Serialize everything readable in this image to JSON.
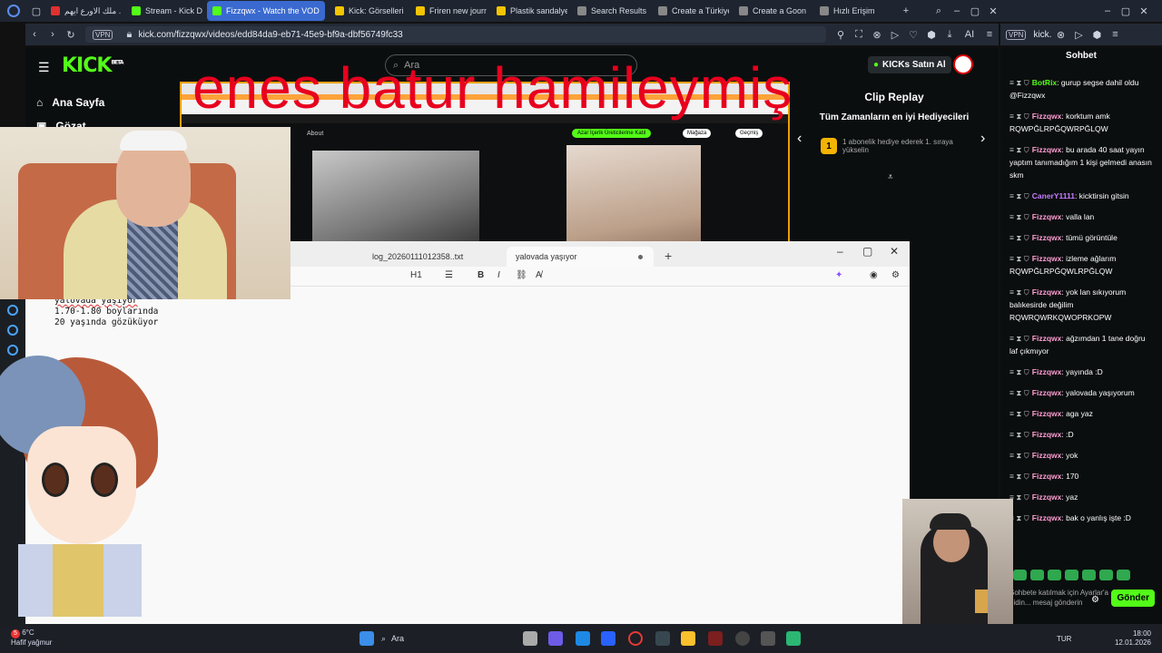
{
  "browser": {
    "tabs": [
      {
        "label": "ملك الاورع ايهم ...",
        "color": "#e03030"
      },
      {
        "label": "Stream - Kick D",
        "color": "#53fc18"
      },
      {
        "label": "Fizzqwx - Watch the VOD",
        "color": "#53fc18"
      },
      {
        "label": "Kick: Görselleri",
        "color": "#f5c400"
      },
      {
        "label": "Friren new journ",
        "color": "#f5c400"
      },
      {
        "label": "Plastik sandalye",
        "color": "#f5c400"
      },
      {
        "label": "Search Results",
        "color": "#888888"
      },
      {
        "label": "Create a Türkiye",
        "color": "#888888"
      },
      {
        "label": "Create a Goon",
        "color": "#888888"
      },
      {
        "label": "Hızlı Erişim",
        "color": "#888888"
      }
    ],
    "url": "kick.com/fizzqwx/videos/edd84da9-eb71-45e9-bf9a-dbf56749fc33",
    "vpn_label": "VPN",
    "second_window_url": "kick.",
    "second_vpn_label": "VPN",
    "ai_label": "AI"
  },
  "kick": {
    "logo": "KICK",
    "beta": "BETA",
    "search_placeholder": "Ara",
    "nav_home": "Ana Sayfa",
    "nav_browse": "Gözat",
    "kicks_button": "KICKs Satın Al",
    "overlay_text": "enes batur hamileymiş",
    "leaderboard_title": "Clip Replay",
    "leaderboard_subtitle": "Tüm Zamanların en iyi Hediyecileri",
    "leaderboard_rank": "1",
    "leaderboard_hint": "1 abonelik hediye ederek 1. sıraya yükselin",
    "screen_about": "About",
    "screen_green_btn": "Azar İçerik Üreticilerine Katıl",
    "screen_store": "Mağaza",
    "screen_history": "Geçmiş"
  },
  "notepad": {
    "tab1": "log_20260111012358..txt",
    "tab2": "yalovada yaşıyor",
    "heading_btn": "H1",
    "lines": [
      "yalovada yaşıyor",
      "1.70-1.80 boylarında",
      "20 yaşında gözüküyor"
    ]
  },
  "chat": {
    "title": "Sohbet",
    "messages": [
      {
        "user": "BotRix",
        "text": "gurup segse dahil oldu @Fizzqwx",
        "style": "green"
      },
      {
        "user": "Fizzqwx",
        "text": "korktum amk RQWPĞLRPĞQWRPĞLQW",
        "style": "pink"
      },
      {
        "user": "Fizzqwx",
        "text": "bu arada 40 saat yayın yaptım tanımadığım 1 kişi gelmedi anasın skm",
        "style": "pink"
      },
      {
        "user": "CanerY1111",
        "text": "kicktirsin gitsin",
        "style": "blue"
      },
      {
        "user": "Fizzqwx",
        "text": "valla lan",
        "style": "pink"
      },
      {
        "user": "Fizzqwx",
        "text": "tümü görüntüle",
        "style": "pink"
      },
      {
        "user": "Fizzqwx",
        "text": "izleme ağlarım RQWPĞLRPĞQWLRPĞLQW",
        "style": "pink"
      },
      {
        "user": "Fizzqwx",
        "text": "yok lan sıkıyorum balıkesirde değilim RQWRQWRKQWOPRKOPW",
        "style": "pink"
      },
      {
        "user": "Fizzqwx",
        "text": "ağzımdan 1 tane doğru laf çıkmıyor",
        "style": "pink"
      },
      {
        "user": "Fizzqwx",
        "text": "yayında :D",
        "style": "pink"
      },
      {
        "user": "Fizzqwx",
        "text": "yalovada yaşıyorum",
        "style": "pink"
      },
      {
        "user": "Fizzqwx",
        "text": "aga yaz",
        "style": "pink"
      },
      {
        "user": "Fizzqwx",
        "text": ":D",
        "style": "pink"
      },
      {
        "user": "Fizzqwx",
        "text": "yok",
        "style": "pink"
      },
      {
        "user": "Fizzqwx",
        "text": "170",
        "style": "pink"
      },
      {
        "user": "Fizzqwx",
        "text": "yaz",
        "style": "pink"
      },
      {
        "user": "Fizzqwx",
        "text": "bak o yanlış işte :D",
        "style": "pink"
      }
    ],
    "input_hint": "Sohbete katılmak için Ayarlar'a gidin... mesaj gönderin",
    "send_label": "Gönder"
  },
  "taskbar": {
    "temperature": "6°C",
    "weather": "Hafif yağmur",
    "notif_count": "5",
    "search": "Ara",
    "lang": "TUR",
    "time": "18:00",
    "date": "12.01.2026"
  },
  "colors": {
    "kick_green": "#53fc18",
    "overlay_red": "#e8001e",
    "chat_user": "#ff9bd2"
  }
}
